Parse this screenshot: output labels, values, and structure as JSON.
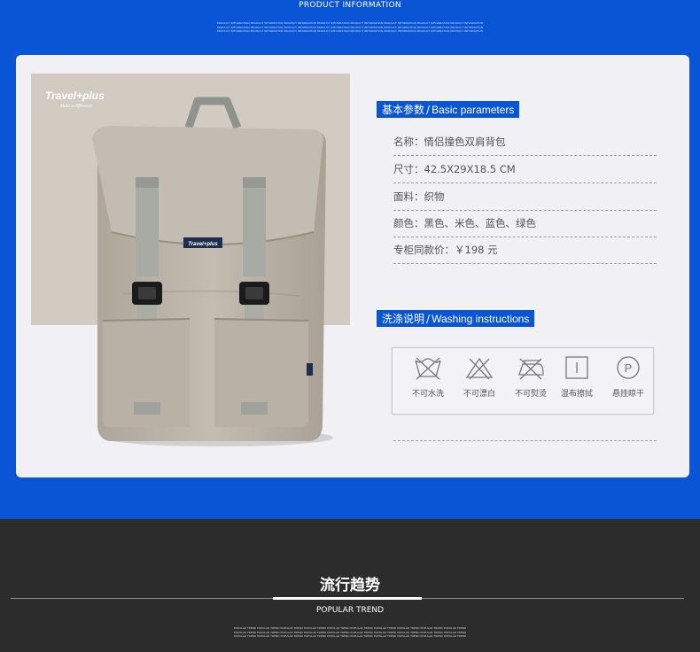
{
  "header": {
    "title": "PRODUCT INFORMATION",
    "fine_print": "PRODUCT INFORMATION PRODUCT INFORMATION PRODUCT INFORMATION PRODUCT INFORMATION PRODUCT INFORMATION PRODUCT INFORMATION PRODUCT INFORMATION PRODUCT INFORMATION"
  },
  "product_image": {
    "brand": "Travel+plus",
    "tagline": "Make a difference",
    "strap_tag": "Travel+plus"
  },
  "basic": {
    "heading_cn": "基本参数",
    "separator": "/",
    "heading_en": "Basic parameters",
    "rows": [
      "名称：情侣撞色双肩背包",
      "尺寸：42.5X29X18.5 CM",
      "面料：织物",
      "颜色：黑色、米色、蓝色、绿色",
      "专柜同款价：￥198 元"
    ]
  },
  "washing": {
    "heading_cn": "洗涤说明",
    "separator": "/",
    "heading_en": "Washing instructions",
    "items": [
      {
        "icon": "no-wash-icon",
        "label": "不可水洗"
      },
      {
        "icon": "no-bleach-icon",
        "label": "不可漂白"
      },
      {
        "icon": "no-iron-icon",
        "label": "不可熨烫"
      },
      {
        "icon": "wet-wipe-icon",
        "label": "湿布擦拭"
      },
      {
        "icon": "hang-dry-icon",
        "label": "悬挂晾干"
      }
    ]
  },
  "trend": {
    "title_cn": "流行趋势",
    "title_en": "POPULAR TREND",
    "fine_print": "POPULAR TREND POPULAR TREND POPULAR TREND POPULAR TREND POPULAR TREND POPULAR TREND POPULAR TREND POPULAR TREND POPULAR TREND POPULAR TREND"
  },
  "colors": {
    "accent_blue": "#0a55d6",
    "card_bg": "#f0f0f5",
    "dark_bg": "#2c2c2c",
    "bag_beige": "#bcb4a8"
  }
}
